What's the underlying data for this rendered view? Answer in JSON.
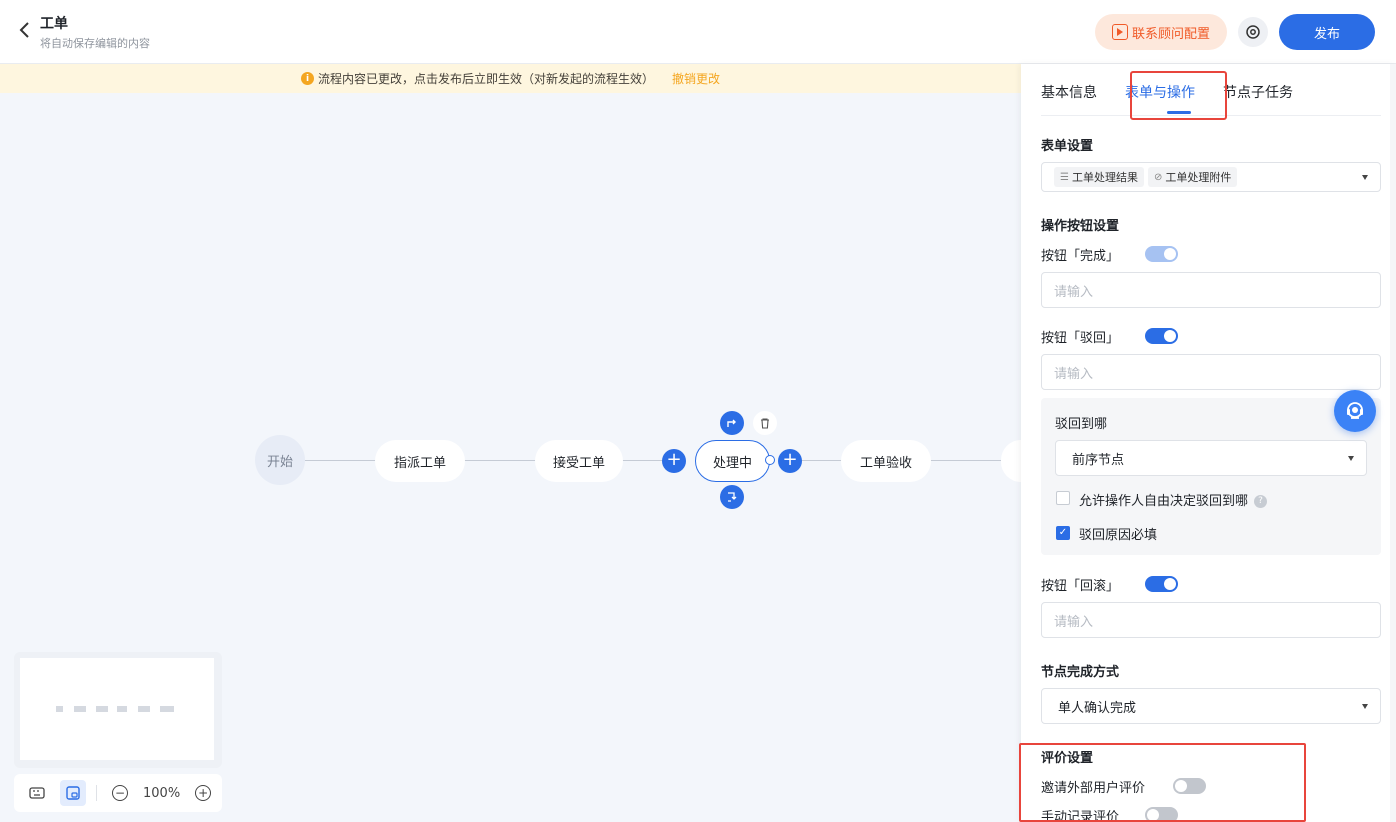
{
  "header": {
    "title": "工单",
    "subtitle": "将自动保存编辑的内容",
    "consult_label": "联系顾问配置",
    "publish_label": "发布"
  },
  "notice": {
    "text": "流程内容已更改，点击发布后立即生效（对新发起的流程生效）",
    "undo_label": "撤销更改"
  },
  "flow": {
    "nodes": [
      {
        "label": "开始"
      },
      {
        "label": "指派工单"
      },
      {
        "label": "接受工单"
      },
      {
        "label": "处理中"
      },
      {
        "label": "工单验收"
      }
    ]
  },
  "zoom": {
    "level": "100%"
  },
  "panel": {
    "tabs": [
      "基本信息",
      "表单与操作",
      "节点子任务"
    ],
    "active_tab": "表单与操作",
    "form_settings": {
      "title": "表单设置",
      "chips": [
        "工单处理结果",
        "工单处理附件"
      ]
    },
    "button_settings": {
      "title": "操作按钮设置",
      "complete": {
        "label": "按钮「完成」",
        "enabled": true,
        "placeholder": "请输入"
      },
      "reject": {
        "label": "按钮「驳回」",
        "enabled": true,
        "placeholder": "请输入"
      },
      "rollback": {
        "label": "按钮「回滚」",
        "enabled": true,
        "placeholder": "请输入"
      }
    },
    "reject_target": {
      "title": "驳回到哪",
      "selected": "前序节点",
      "allow_free_label": "允许操作人自由决定驳回到哪",
      "allow_free_checked": false,
      "reason_required_label": "驳回原因必填",
      "reason_required_checked": true
    },
    "completion": {
      "title": "节点完成方式",
      "selected": "单人确认完成"
    },
    "evaluation": {
      "title": "评价设置",
      "invite_external_label": "邀请外部用户评价",
      "invite_external_enabled": false,
      "manual_record_label": "手动记录评价",
      "manual_record_enabled": false
    }
  },
  "colors": {
    "primary": "#2b6de5",
    "highlight_border": "#e8453c",
    "warning": "#f4a620"
  }
}
